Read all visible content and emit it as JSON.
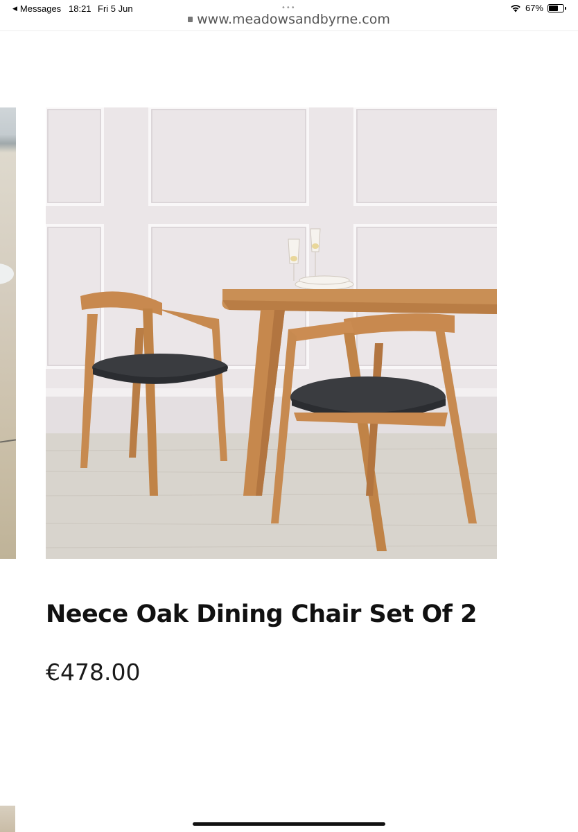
{
  "status_bar": {
    "back_app": "Messages",
    "time": "18:21",
    "date": "Fri 5 Jun",
    "battery": "67%",
    "battery_level": 0.67,
    "icons": [
      "back-arrow-icon",
      "wifi-icon",
      "battery-icon"
    ]
  },
  "browser": {
    "menu_dots": "•••",
    "url": "www.meadowsandbyrne.com"
  },
  "product": {
    "title": "Neece Oak Dining Chair Set Of 2",
    "price": "€478.00"
  }
}
